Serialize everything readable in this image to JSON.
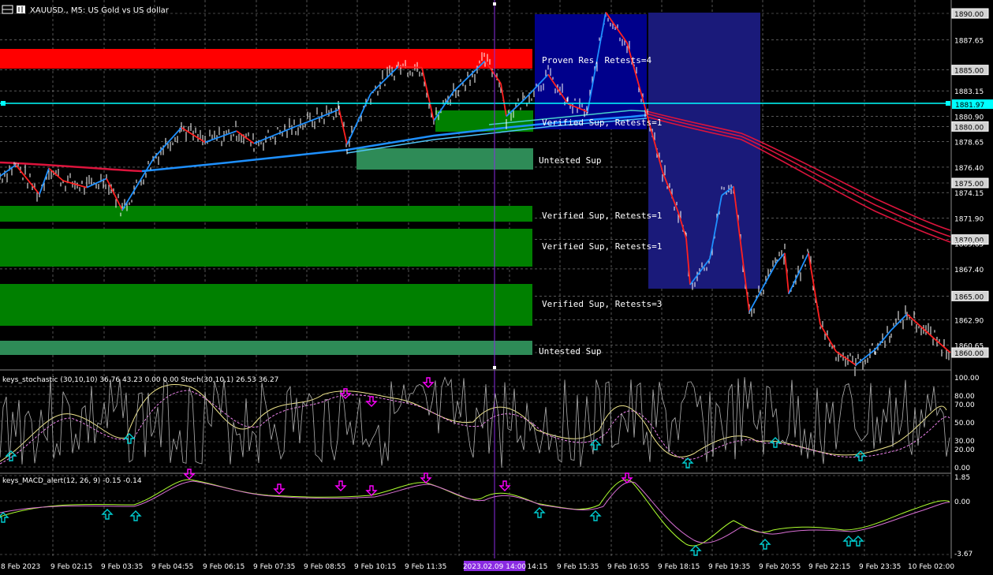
{
  "window": {
    "symbol_title": "XAUUSD., M5:  US Gold vs US dollar",
    "stoch_title": "keys_stochastic (30,10,10) 36.76 43.23 0.00 0.00 Stoch(30,10,1) 26.53 36.27",
    "macd_title": "keys_MACD_alert(12, 26, 9) -0.15 -0.14",
    "crosshair_time": "2023.02.09 14:00"
  },
  "colors": {
    "background": "#000000",
    "grid": "#8a8a8a",
    "resistance_zone": "#ff0000",
    "support_zone": "#008000",
    "untested_zone": "#2e8b57",
    "session_box_1": "#00008b",
    "session_box_2": "#191970",
    "zigzag_up": "#1e90ff",
    "zigzag_down": "#ff0000",
    "ma_line": "#dc143c",
    "price_level_line": "#00ffff",
    "crosshair": "#8a2be2",
    "candle": "#ffffff"
  },
  "price_axis": {
    "labels": [
      "1890.00",
      "1887.65",
      "1885.00",
      "1883.15",
      "1881.97",
      "1880.90",
      "1880.00",
      "1878.65",
      "1876.40",
      "1875.00",
      "1874.15",
      "1871.90",
      "1870.00",
      "1869.65",
      "1867.40",
      "1865.00",
      "1862.90",
      "1860.65",
      "1860.00"
    ],
    "boxed": [
      "1890.00",
      "1885.00",
      "1880.00",
      "1875.00",
      "1870.00",
      "1865.00",
      "1860.00"
    ],
    "current_level": "1881.97"
  },
  "zones": [
    {
      "label": "Proven Res, Retests=4",
      "type": "resistance",
      "lo": 1884.3,
      "hi": 1886.3
    },
    {
      "label": "Verified Sup, Retests=1",
      "type": "support",
      "lo": 1879.7,
      "hi": 1881.3
    },
    {
      "label": "Untested Sup",
      "type": "untested",
      "lo": 1876.0,
      "hi": 1877.8
    },
    {
      "label": "Verified Sup, Retests=1",
      "type": "support",
      "lo": 1871.8,
      "hi": 1873.1
    },
    {
      "label": "Verified Sup, Retests=1",
      "type": "support",
      "lo": 1868.2,
      "hi": 1871.4
    },
    {
      "label": "Verified Sup, Retests=3",
      "type": "support",
      "lo": 1862.6,
      "hi": 1866.6
    },
    {
      "label": "Untested Sup",
      "type": "untested",
      "lo": 1860.0,
      "hi": 1861.3
    }
  ],
  "time_axis": [
    "8 Feb 2023",
    "9 Feb 02:15",
    "9 Feb 03:35",
    "9 Feb 04:55",
    "9 Feb 06:15",
    "9 Feb 07:35",
    "9 Feb 08:55",
    "9 Feb 10:15",
    "9 Feb 11:35",
    "9 Feb 12:55",
    "9 Feb 14:15",
    "9 Feb 15:35",
    "9 Feb 16:55",
    "9 Feb 18:15",
    "9 Feb 19:35",
    "9 Feb 20:55",
    "9 Feb 22:15",
    "9 Feb 23:35",
    "10 Feb 02:00"
  ],
  "stoch_axis": [
    "100.00",
    "80.00",
    "70.00",
    "50.00",
    "30.00",
    "20.00",
    "0.00"
  ],
  "macd_axis": [
    "1.85",
    "0.00",
    "-3.67"
  ],
  "chart_data": {
    "type": "line",
    "symbol": "XAUUSD.",
    "timeframe": "M5",
    "zigzag_price": [
      [
        0,
        1875.6
      ],
      [
        1,
        1876.6
      ],
      [
        2,
        1874.0
      ],
      [
        3,
        1876.3
      ],
      [
        4,
        1875.2
      ],
      [
        5,
        1874.6
      ],
      [
        6,
        1875.4
      ],
      [
        7,
        1872.6
      ],
      [
        8,
        1877.2
      ],
      [
        9,
        1879.9
      ],
      [
        10,
        1878.6
      ],
      [
        11,
        1879.6
      ],
      [
        12,
        1878.5
      ],
      [
        13,
        1880.0
      ],
      [
        14,
        1880.8
      ],
      [
        15,
        1881.5
      ],
      [
        16,
        1878.4
      ],
      [
        17,
        1882.9
      ],
      [
        18,
        1885.3
      ],
      [
        19,
        1885.2
      ],
      [
        20,
        1880.5
      ],
      [
        21,
        1883.1
      ],
      [
        22,
        1885.8
      ],
      [
        23,
        1883.8
      ],
      [
        24,
        1880.9
      ],
      [
        25,
        1882.4
      ],
      [
        26,
        1884.6
      ],
      [
        27,
        1882.0
      ],
      [
        28,
        1881.3
      ],
      [
        29,
        1890.1
      ],
      [
        30,
        1887.4
      ],
      [
        31,
        1882.4
      ],
      [
        32,
        1876.0
      ],
      [
        33,
        1872.4
      ],
      [
        34,
        1870.1
      ],
      [
        35,
        1866.0
      ],
      [
        36,
        1868.3
      ],
      [
        37,
        1873.9
      ],
      [
        38,
        1874.7
      ],
      [
        39,
        1863.6
      ],
      [
        40,
        1868.0
      ],
      [
        41,
        1868.8
      ],
      [
        42,
        1865.2
      ],
      [
        43,
        1868.8
      ],
      [
        44,
        1862.5
      ],
      [
        45,
        1860.1
      ],
      [
        46,
        1858.9
      ],
      [
        47,
        1860.3
      ],
      [
        48,
        1862.0
      ],
      [
        49,
        1863.4
      ],
      [
        50,
        1861.2
      ],
      [
        51,
        1860.0
      ]
    ],
    "stochastic": {
      "main": 36.76,
      "signal": 43.23,
      "stoch_main": 26.53,
      "stoch_signal": 36.27,
      "range": [
        0,
        100
      ]
    },
    "macd": {
      "macd": -0.15,
      "signal": -0.14,
      "range": [
        -3.67,
        1.85
      ]
    }
  }
}
